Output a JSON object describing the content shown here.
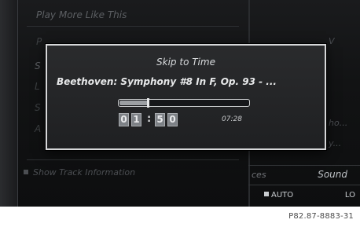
{
  "background_menu": {
    "items": [
      "Play More Like This",
      "P",
      "S",
      "L",
      "S",
      "A"
    ],
    "footer": "Show Track Information"
  },
  "right_panel": {
    "item_top": "V",
    "items": [
      "ho...",
      "y..."
    ],
    "tabs": {
      "services": "ces",
      "sound": "Sound"
    },
    "status": {
      "auto": "AUTO",
      "lo": "LO"
    }
  },
  "dialog": {
    "title": "Skip to Time",
    "track": "Beethoven: Symphony #8 In F, Op. 93 - ...",
    "progress_fraction": 0.22,
    "duration": "07:28",
    "time_digits": [
      "0",
      "1",
      "5",
      "0"
    ],
    "time_separator": ":"
  },
  "caption": "P82.87-8883-31"
}
